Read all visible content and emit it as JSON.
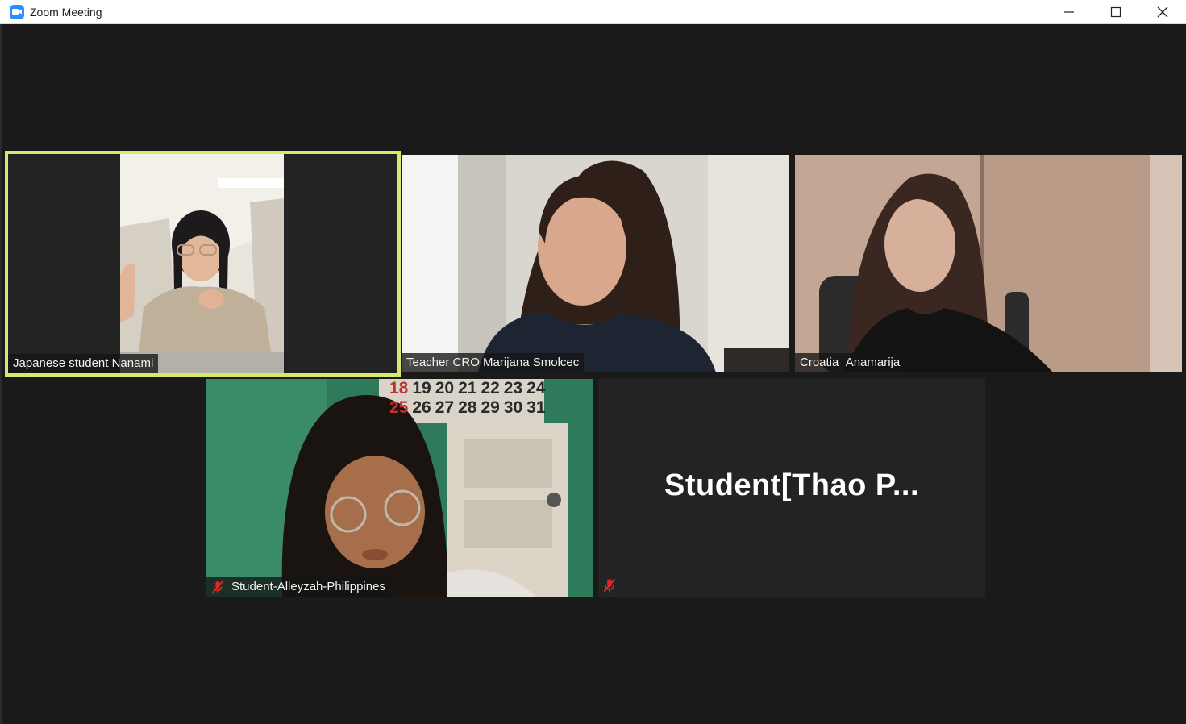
{
  "window": {
    "title": "Zoom Meeting",
    "icon": "zoom-camera-icon",
    "controls": [
      "minimize-icon",
      "maximize-icon",
      "close-icon"
    ]
  },
  "participants": [
    {
      "name": "Japanese student Nanami",
      "active_speaker": true,
      "muted": false,
      "video": true
    },
    {
      "name": "Teacher CRO Marijana Smolcec",
      "active_speaker": false,
      "muted": false,
      "video": true
    },
    {
      "name": "Croatia_Anamarija",
      "active_speaker": false,
      "muted": false,
      "video": true
    },
    {
      "name": "Student-Alleyzah-Philippines",
      "active_speaker": false,
      "muted": true,
      "video": true
    },
    {
      "name": "Student[Thao  P...",
      "active_speaker": false,
      "muted": true,
      "video": false
    }
  ],
  "calendar": {
    "row1": [
      "18",
      "19",
      "20",
      "21",
      "22",
      "23",
      "24"
    ],
    "row2": [
      "25",
      "26",
      "27",
      "28",
      "29",
      "30",
      "31"
    ]
  },
  "colors": {
    "active_outline": "#d7e86a",
    "stage_bg": "#1a1a1a",
    "tile_bg": "#232323",
    "mute_red": "#e02828",
    "zoom_blue": "#2d8cff"
  }
}
